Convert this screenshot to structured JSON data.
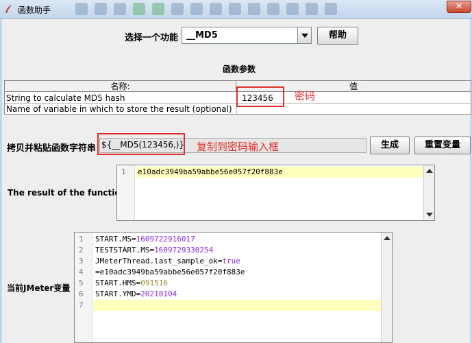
{
  "window": {
    "title": "函数助手",
    "close_glyph": "✕"
  },
  "selector": {
    "label": "选择一个功能",
    "selected": "__MD5",
    "help_button": "帮助"
  },
  "params": {
    "section_title": "函数参数",
    "columns": [
      "名称:",
      "值"
    ],
    "rows": [
      {
        "name": "String to calculate MD5 hash",
        "value": "123456"
      },
      {
        "name": "Name of variable in which to store the result (optional)",
        "value": ""
      }
    ]
  },
  "annotations": {
    "password_note": "密码",
    "copy_note": "复制到密码输入框"
  },
  "function_string": {
    "label": "拷贝并粘贴函数字符串",
    "value": "${__MD5(123456,)}",
    "generate_button": "生成",
    "reset_button": "重置变量"
  },
  "result": {
    "label": "The result of the function is",
    "line_numbers": [
      "1"
    ],
    "text": "e10adc3949ba59abbe56e057f20f883e"
  },
  "variables": {
    "label": "当前JMeter变量",
    "line_numbers": [
      "1",
      "2",
      "3",
      "4",
      "5",
      "6",
      "7"
    ],
    "lines": [
      {
        "key": "START.MS",
        "eq": "=",
        "value": "1609722916017",
        "kind": "num"
      },
      {
        "key": "TESTSTART.MS",
        "eq": "=",
        "value": "1609729330254",
        "kind": "num"
      },
      {
        "key": "JMeterThread.last_sample_ok",
        "eq": "=",
        "value": "true",
        "kind": "bool"
      },
      {
        "key": "",
        "eq": "=",
        "value": "e10adc3949ba59abbe56e057f20f883e",
        "kind": "plain"
      },
      {
        "key": "START.HMS",
        "eq": "=",
        "value": "091516",
        "kind": "val"
      },
      {
        "key": "START.YMD",
        "eq": "=",
        "value": "20210104",
        "kind": "num"
      },
      {
        "key": "",
        "eq": "",
        "value": "",
        "kind": "plain"
      }
    ]
  },
  "colors": {
    "annotation_red": "#e0302c",
    "highlight_line": "#ffffbe"
  }
}
